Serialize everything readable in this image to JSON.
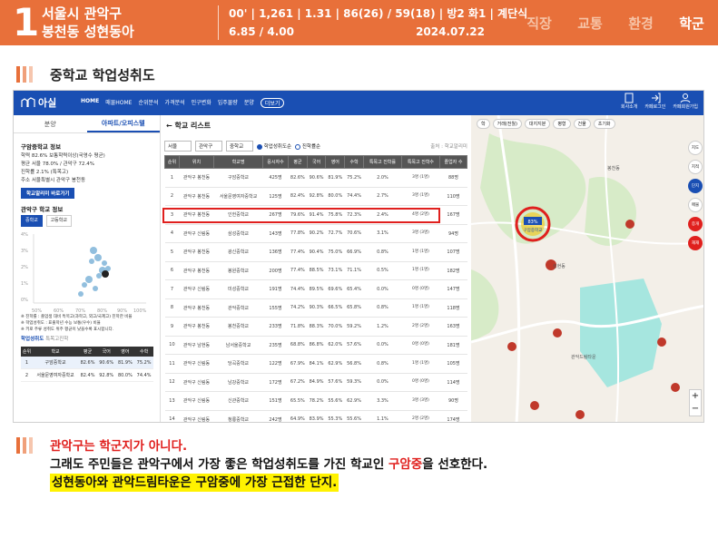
{
  "banner": {
    "number": "1",
    "district": "서울시 관악구",
    "complex": "봉천동 성현동아",
    "stats_line1": "00' | 1,261 | 1.31 | 86(26) / 59(18) | 방2 화1 | 계단식",
    "stats_price": "6.85 / 4.00",
    "stats_date": "2024.07.22",
    "tags": [
      "직장",
      "교통",
      "환경",
      "학군"
    ]
  },
  "section_title": "중학교 학업성취도",
  "screenshot": {
    "nav": {
      "logo": "아실",
      "menu": [
        "HOME",
        "매물HOME",
        "순위분석",
        "가격분석",
        "인구변화",
        "입주물량",
        "분양"
      ],
      "more": "더보기",
      "icons": [
        "회사소개",
        "카페로그인",
        "카페회원가입"
      ]
    },
    "left": {
      "tabs": [
        "분양",
        "아파트/오피스텔"
      ],
      "title": "구암중학교 정보",
      "line1": "학력 82.6% 보통학력이상(국영수 평균)",
      "line2": "평균 서울 78.0% / 관악구 72.4%",
      "line3": "진학률 2.1% (특목고)",
      "line4": "주소 서울특별시 관악구 봉천동",
      "btn": "학교알리미 바로가기",
      "chart_title": "관악구 학교 정보",
      "chips": [
        "중학교",
        "고등학교"
      ],
      "xticks": [
        "50%",
        "60%",
        "70%",
        "80%",
        "90%",
        "100%"
      ],
      "yticks": [
        "4%",
        "3%",
        "2%",
        "1%",
        "0%"
      ],
      "notes": [
        "※ 진학률 : 졸업생 대비 특목고(과학고, 외고/국제고) 진학한 비율",
        "※ 학업성취도 : 표출학년 수능 보통(우수) 비율",
        "※ 키로 주류 성취도 위주 평균이 낮을수록 표시합니다."
      ],
      "sub_label": "학업성취도",
      "sub_label2": "특목고진학",
      "mini_headers": [
        "순위",
        "학교",
        "평균",
        "국어",
        "영어",
        "수학"
      ],
      "mini_rows": [
        [
          "1",
          "구암중학교",
          "82.6%",
          "90.6%",
          "81.9%",
          "75.2%"
        ],
        [
          "2",
          "서울문영여자중학교",
          "82.4%",
          "92.8%",
          "80.0%",
          "74.4%"
        ]
      ]
    },
    "list": {
      "title": "학교 리스트",
      "filters": [
        "서울",
        "관악구",
        "중학교"
      ],
      "radio1": "학업성취도순",
      "radio2": "진학률순",
      "source": "출처 : 학교알리미",
      "headers": [
        "순위",
        "위치",
        "학교명",
        "응시자수",
        "평균",
        "국어",
        "영어",
        "수학",
        "특목고 진학률",
        "특목고 진학수",
        "졸업자 수"
      ],
      "rows": [
        [
          "1",
          "관악구 봉천동",
          "구암중학교",
          "425명",
          "82.6%",
          "90.6%",
          "81.9%",
          "75.2%",
          "2.0%",
          "3명 (1명)",
          "88명"
        ],
        [
          "2",
          "관악구 봉천동",
          "서울문영여자중학교",
          "125명",
          "82.4%",
          "92.8%",
          "80.0%",
          "74.4%",
          "2.7%",
          "3명 (1명)",
          "110명"
        ],
        [
          "3",
          "관악구 봉천동",
          "인헌중학교",
          "267명",
          "79.6%",
          "91.4%",
          "75.8%",
          "72.3%",
          "2.4%",
          "4명 (2명)",
          "167명"
        ],
        [
          "4",
          "관악구 신림동",
          "삼성중학교",
          "143명",
          "77.8%",
          "90.2%",
          "72.7%",
          "70.6%",
          "3.1%",
          "3명 (3명)",
          "94명"
        ],
        [
          "5",
          "관악구 봉천동",
          "광신중학교",
          "136명",
          "77.4%",
          "90.4%",
          "75.0%",
          "66.9%",
          "0.8%",
          "1명 (1명)",
          "107명"
        ],
        [
          "6",
          "관악구 봉천동",
          "봉원중학교",
          "200명",
          "77.4%",
          "88.5%",
          "73.1%",
          "71.1%",
          "0.5%",
          "1명 (1명)",
          "182명"
        ],
        [
          "7",
          "관악구 신림동",
          "미성중학교",
          "191명",
          "74.4%",
          "89.5%",
          "69.6%",
          "65.4%",
          "0.0%",
          "0명 (0명)",
          "147명"
        ],
        [
          "8",
          "관악구 봉천동",
          "관악중학교",
          "155명",
          "74.2%",
          "90.3%",
          "66.5%",
          "65.8%",
          "0.8%",
          "1명 (1명)",
          "118명"
        ],
        [
          "9",
          "관악구 봉천동",
          "봉천중학교",
          "233명",
          "71.8%",
          "88.3%",
          "70.0%",
          "59.2%",
          "1.2%",
          "2명 (2명)",
          "163명"
        ],
        [
          "10",
          "관악구 남현동",
          "남서울중학교",
          "235명",
          "68.8%",
          "86.8%",
          "62.0%",
          "57.6%",
          "0.0%",
          "0명 (0명)",
          "181명"
        ],
        [
          "11",
          "관악구 신림동",
          "당곡중학교",
          "122명",
          "67.9%",
          "84.1%",
          "62.9%",
          "56.8%",
          "0.8%",
          "1명 (1명)",
          "105명"
        ],
        [
          "12",
          "관악구 신림동",
          "남강중학교",
          "172명",
          "67.2%",
          "84.9%",
          "57.6%",
          "59.3%",
          "0.0%",
          "0명 (0명)",
          "114명"
        ],
        [
          "13",
          "관악구 신림동",
          "신관중학교",
          "151명",
          "65.5%",
          "78.2%",
          "55.6%",
          "62.9%",
          "3.3%",
          "3명 (3명)",
          "90명"
        ],
        [
          "14",
          "관악구 신림동",
          "청룡중학교",
          "242명",
          "64.9%",
          "83.9%",
          "55.3%",
          "55.6%",
          "1.1%",
          "2명 (2명)",
          "174명"
        ]
      ]
    },
    "map": {
      "toolbar": [
        "학",
        "거래(전월)",
        "대지지분",
        "평형",
        "건물",
        "초기화"
      ],
      "side": [
        "지도",
        "지적",
        "단지",
        "매물",
        "증개",
        "재재"
      ],
      "marker": "83%",
      "marker_label": "구암중학교",
      "places": [
        "구암중학교",
        "성현동",
        "봉천동",
        "관악드림타운"
      ]
    }
  },
  "caption": {
    "line1": "관악구는 학군지가 아니다.",
    "line2_a": "그래도 주민들은 관악구에서 가장 좋은 학업성취도를 가진 학교인 ",
    "line2_b": "구암중",
    "line2_c": "을 선호한다.",
    "line3": "성현동아와 관악드림타운은 구암중에 가장 근접한 단지."
  }
}
